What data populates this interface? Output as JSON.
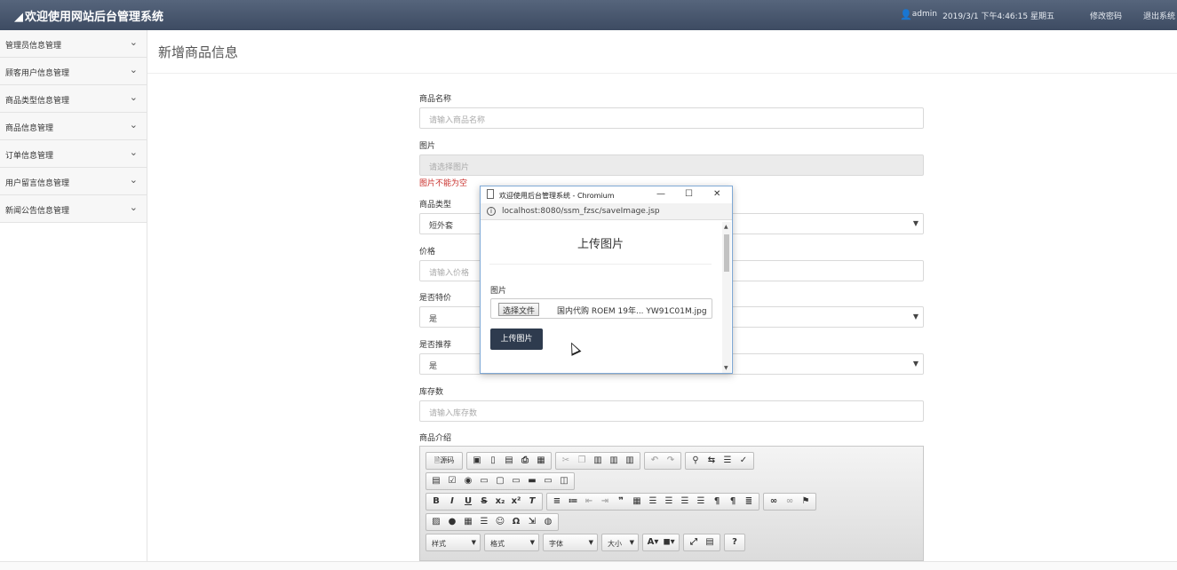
{
  "app": {
    "brand": "欢迎使用网站后台管理系统",
    "user": "admin",
    "datetime": "2019/3/1 下午4:46:15 星期五",
    "change_password": "修改密码",
    "logout": "退出系统"
  },
  "sidebar": {
    "items": [
      {
        "label": "管理员信息管理"
      },
      {
        "label": "顾客用户信息管理"
      },
      {
        "label": "商品类型信息管理"
      },
      {
        "label": "商品信息管理"
      },
      {
        "label": "订单信息管理"
      },
      {
        "label": "用户留言信息管理"
      },
      {
        "label": "新闻公告信息管理"
      }
    ]
  },
  "page": {
    "title": "新增商品信息"
  },
  "form": {
    "name": {
      "label": "商品名称",
      "placeholder": "请输入商品名称"
    },
    "image": {
      "label": "图片",
      "placeholder": "请选择图片",
      "error": "图片不能为空"
    },
    "type": {
      "label": "商品类型",
      "value": "短外套"
    },
    "price": {
      "label": "价格",
      "placeholder": "请输入价格"
    },
    "special": {
      "label": "是否特价",
      "value": "是"
    },
    "recommend": {
      "label": "是否推荐",
      "value": "是"
    },
    "stock": {
      "label": "库存数",
      "placeholder": "请输入库存数"
    },
    "intro": {
      "label": "商品介绍"
    }
  },
  "editor": {
    "source_label": "源码",
    "style_combo": "样式",
    "format_combo": "格式",
    "font_combo": "字体",
    "size_combo": "大小",
    "help_label": "?"
  },
  "popup": {
    "window_title": "欢迎使用后台管理系统 - Chromium",
    "url": "localhost:8080/ssm_fzsc/saveImage.jsp",
    "heading": "上传图片",
    "field_label": "图片",
    "choose_file": "选择文件",
    "file_name": "国内代购 ROEM 19年... YW91C01M.jpg",
    "upload_button": "上传图片"
  }
}
